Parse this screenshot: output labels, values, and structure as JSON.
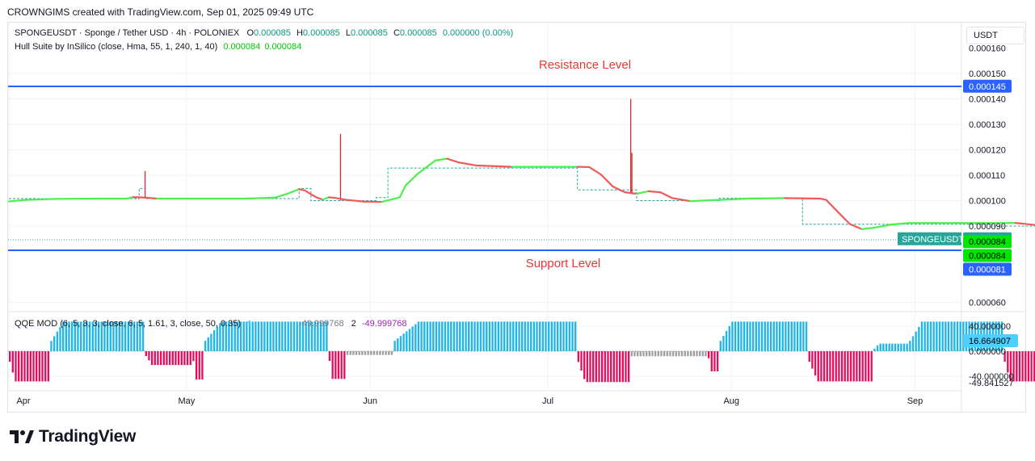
{
  "header": {
    "caption": "CROWNGIMS created with TradingView.com, Sep 01, 2025 09:49 UTC"
  },
  "legend": {
    "symbol_line": "SPONGEUSDT · Sponge / Tether USD · 4h · POLONIEX",
    "o_label": "O",
    "o": "0.000085",
    "h_label": "H",
    "h": "0.000085",
    "l_label": "L",
    "l": "0.000085",
    "c_label": "C",
    "c": "0.000085",
    "change": "0.000000 (0.00%)",
    "hull_label": "Hull Suite by InSilico (close, Hma, 55, 1, 240, 1, 40)",
    "hull_v1": "0.000084",
    "hull_v2": "0.000084",
    "qqe_label": "QQE MOD (6, 5, 3, 3, close, 6, 5, 1.61, 3, close, 50, 0.35)",
    "qqe_v1": "-4",
    "qqe_v2": "-49.999768",
    "qqe_v3": "2",
    "qqe_v4": "-49.999768"
  },
  "currency_button": "USDT",
  "annotations": {
    "resistance": "Resistance Level",
    "support": "Support Level"
  },
  "price_axis": {
    "ticks": [
      "0.000160",
      "0.000150",
      "0.000140",
      "0.000130",
      "0.000120",
      "0.000110",
      "0.000100",
      "0.000090",
      "0.000060"
    ],
    "tick_values": [
      0.00016,
      0.00015,
      0.00014,
      0.00013,
      0.00012,
      0.00011,
      0.0001,
      9e-05,
      6e-05
    ],
    "labels": [
      {
        "text": "0.000145",
        "value": 0.000145,
        "bg": "#2962ff"
      },
      {
        "text": "0.000085",
        "value": 8.5e-05,
        "bg": "#26a69a"
      },
      {
        "text": "0.000084",
        "value": 8.39e-05,
        "bg": "#00e600"
      },
      {
        "text": "0.000084",
        "value": 7.84e-05,
        "bg": "#00e600"
      },
      {
        "text": "0.000081",
        "value": 7.3e-05,
        "bg": "#2962ff"
      }
    ],
    "symbol_tag": "SPONGEUSDT"
  },
  "osc_axis": {
    "ticks": [
      {
        "text": "40.000000",
        "value": 40
      },
      {
        "text": "0.000000",
        "value": 0
      },
      {
        "text": "-40.000000",
        "value": -40
      }
    ],
    "labels": [
      {
        "text": "16.664907",
        "value": 16.66,
        "bg": "#4dd0ff"
      },
      {
        "text": "-49.841527",
        "value": -49.84,
        "bg": null
      }
    ]
  },
  "time_axis": {
    "labels": [
      "Apr",
      "May",
      "Jun",
      "Jul",
      "Aug",
      "Sep"
    ],
    "day_index": [
      0,
      30,
      61,
      91,
      122,
      153
    ]
  },
  "brand": {
    "name": "TradingView"
  },
  "colors": {
    "hull_up": "#4cf04c",
    "hull_down": "#f05a5a",
    "qqe_pos": "#20b6e6",
    "qqe_neg": "#e0125f",
    "qqe_neutral": "#a0a0a0",
    "level_line": "#2962ff",
    "annotation": "#e53935",
    "candle": "#d32f2f",
    "candle_up": "#26a69a"
  },
  "chart_data": [
    {
      "type": "line",
      "title": "SPONGEUSDT · Sponge / Tether USD · 4h · POLONIEX",
      "x_unit": "days since Apr 1 2025",
      "ylim": [
        5.6e-05,
        0.000162
      ],
      "series": [
        {
          "name": "Hull Suite by InSilico (close, Hma, 55, 1, 240, 1, 40)",
          "points": [
            [
              0,
              9.97e-05
            ],
            [
              3,
              0.0001003
            ],
            [
              8,
              0.0001007
            ],
            [
              15,
              0.0001008
            ],
            [
              20,
              0.0001008
            ],
            [
              21,
              0.0001014
            ],
            [
              23,
              0.0001012
            ],
            [
              25,
              0.0001008
            ],
            [
              30,
              0.0001008
            ],
            [
              40,
              0.0001008
            ],
            [
              45,
              0.0001012
            ],
            [
              47,
              0.0001027
            ],
            [
              49,
              0.0001045
            ],
            [
              50,
              0.000104
            ],
            [
              51,
              0.0001025
            ],
            [
              52,
              0.0001012
            ],
            [
              53,
              0.0001004
            ],
            [
              54,
              0.0001013
            ],
            [
              55,
              0.0001011
            ],
            [
              57,
              0.0001003
            ],
            [
              60,
              9.96e-05
            ],
            [
              63,
              9.95e-05
            ],
            [
              66,
              0.0001013
            ],
            [
              67,
              0.000106
            ],
            [
              69,
              0.0001105
            ],
            [
              71,
              0.000114
            ],
            [
              72,
              0.0001158
            ],
            [
              74,
              0.0001165
            ],
            [
              76,
              0.000115
            ],
            [
              79,
              0.0001138
            ],
            [
              85,
              0.0001133
            ],
            [
              96,
              0.0001133
            ],
            [
              98,
              0.0001132
            ],
            [
              100,
              0.0001102
            ],
            [
              102,
              0.0001055
            ],
            [
              104,
              0.0001033
            ],
            [
              106,
              0.0001027
            ],
            [
              108,
              0.0001037
            ],
            [
              110,
              0.0001033
            ],
            [
              112,
              0.000101
            ],
            [
              115,
              9.98e-05
            ],
            [
              120,
              0.0001003
            ],
            [
              125,
              0.0001008
            ],
            [
              131,
              0.000101
            ],
            [
              137,
              0.0001008
            ],
            [
              138,
              0.0001003
            ],
            [
              140,
              9.55e-05
            ],
            [
              142,
              9.08e-05
            ],
            [
              144,
              8.88e-05
            ],
            [
              146,
              8.93e-05
            ],
            [
              149,
              9.06e-05
            ],
            [
              152,
              9.12e-05
            ],
            [
              160,
              9.12e-05
            ],
            [
              170,
              9.12e-05
            ],
            [
              171,
              9.1e-05
            ],
            [
              173,
              9.05e-05
            ],
            [
              175,
              9.01e-05
            ],
            [
              180,
              9e-05
            ],
            [
              182,
              9.01e-05
            ],
            [
              183,
              8.85e-05
            ],
            [
              184,
              8.6e-05
            ]
          ]
        },
        {
          "name": "SPONGEUSDT",
          "spikes": [
            {
              "x": 23,
              "high": 0.0001117,
              "low": 0.0001008
            },
            {
              "x": 56,
              "high": 0.0001263,
              "low": 0.0001
            },
            {
              "x": 105,
              "high": 0.00014,
              "low": 0.0001033
            },
            {
              "x": 105.2,
              "high": 0.0001188,
              "low": 0.0001025
            }
          ],
          "steps": [
            [
              0,
              0.0001008
            ],
            [
              22,
              0.0001008
            ],
            [
              22,
              0.0001048
            ],
            [
              23,
              0.0001048
            ],
            [
              23,
              0.0001008
            ],
            [
              49,
              0.0001008
            ],
            [
              49,
              0.0001048
            ],
            [
              51,
              0.0001048
            ],
            [
              51,
              0.0001
            ],
            [
              62,
              0.0001
            ],
            [
              62,
              0.0001012
            ],
            [
              64,
              0.0001012
            ],
            [
              64,
              0.0001128
            ],
            [
              96,
              0.0001128
            ],
            [
              96,
              0.0001042
            ],
            [
              106,
              0.0001042
            ],
            [
              106,
              0.0001
            ],
            [
              120,
              0.0001
            ],
            [
              120,
              0.000101
            ],
            [
              134,
              0.000101
            ],
            [
              134,
              9.07e-05
            ],
            [
              166,
              9.07e-05
            ],
            [
              166,
              9e-05
            ],
            [
              183,
              9e-05
            ],
            [
              183,
              8.5e-05
            ]
          ]
        }
      ]
    },
    {
      "type": "bar",
      "title": "QQE MOD (6, 5, 3, 3, close, 6, 5, 1.61, 3, close, 50, 0.35)",
      "x_unit": "days since Apr 1 2025",
      "ylim": [
        -50,
        50
      ],
      "segments": [
        {
          "from": 0,
          "to": 7,
          "value": -48,
          "state": "neg"
        },
        {
          "from": 7,
          "to": 23,
          "value": 47,
          "state": "pos"
        },
        {
          "from": 23,
          "to": 31,
          "value": -22,
          "state": "neg"
        },
        {
          "from": 31,
          "to": 33,
          "value": -45,
          "state": "neg"
        },
        {
          "from": 33,
          "to": 54,
          "value": 47,
          "state": "pos"
        },
        {
          "from": 54,
          "to": 57,
          "value": -44,
          "state": "neg"
        },
        {
          "from": 57,
          "to": 65,
          "value": -6,
          "state": "neutral"
        },
        {
          "from": 65,
          "to": 96,
          "value": 47,
          "state": "pos"
        },
        {
          "from": 96,
          "to": 105,
          "value": -49,
          "state": "neg"
        },
        {
          "from": 105,
          "to": 118,
          "value": -8,
          "state": "neutral"
        },
        {
          "from": 118,
          "to": 120,
          "value": -32,
          "state": "neg"
        },
        {
          "from": 120,
          "to": 135,
          "value": 47,
          "state": "pos"
        },
        {
          "from": 135,
          "to": 146,
          "value": -48,
          "state": "neg"
        },
        {
          "from": 146,
          "to": 152,
          "value": 12,
          "state": "pos"
        },
        {
          "from": 152,
          "to": 168,
          "value": 47,
          "state": "pos"
        },
        {
          "from": 168,
          "to": 175,
          "value": -48,
          "state": "neg"
        },
        {
          "from": 175,
          "to": 180,
          "value": 47,
          "state": "pos"
        },
        {
          "from": 180,
          "to": 186,
          "value": -48,
          "state": "neg"
        }
      ]
    }
  ]
}
